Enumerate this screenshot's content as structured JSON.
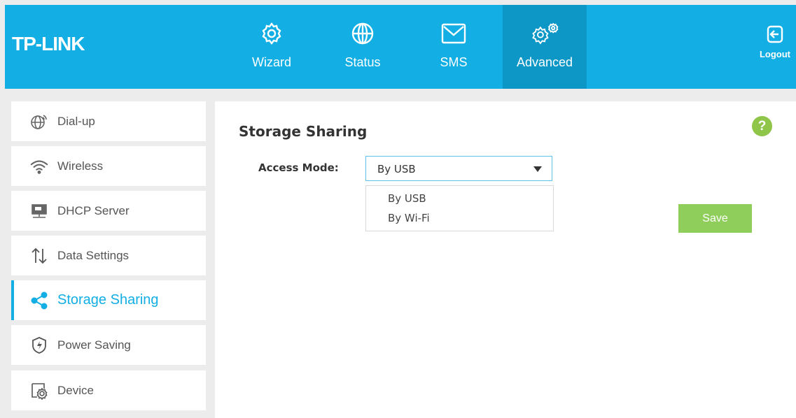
{
  "brand": {
    "logo": "TP-LINK"
  },
  "nav": {
    "items": [
      {
        "label": "Wizard",
        "icon": "gear-icon"
      },
      {
        "label": "Status",
        "icon": "globe-icon"
      },
      {
        "label": "SMS",
        "icon": "envelope-icon"
      },
      {
        "label": "Advanced",
        "icon": "gears-icon",
        "active": true
      }
    ],
    "logout_label": "Logout"
  },
  "sidebar": {
    "items": [
      {
        "label": "Dial-up",
        "icon": "globe-signal-icon"
      },
      {
        "label": "Wireless",
        "icon": "wifi-icon"
      },
      {
        "label": "DHCP Server",
        "icon": "server-icon"
      },
      {
        "label": "Data Settings",
        "icon": "up-down-arrows-icon"
      },
      {
        "label": "Storage Sharing",
        "icon": "share-icon",
        "active": true
      },
      {
        "label": "Power Saving",
        "icon": "power-saving-icon"
      },
      {
        "label": "Device",
        "icon": "device-settings-icon"
      }
    ]
  },
  "main": {
    "title": "Storage Sharing",
    "help": "?",
    "access_mode": {
      "label": "Access Mode:",
      "selected": "By USB",
      "options": [
        "By USB",
        "By Wi-Fi"
      ]
    },
    "save_label": "Save"
  },
  "colors": {
    "header_bg": "#12aee4",
    "header_active": "#0c97c7",
    "accent_green": "#8fce5b",
    "help_green": "#8fc549"
  }
}
